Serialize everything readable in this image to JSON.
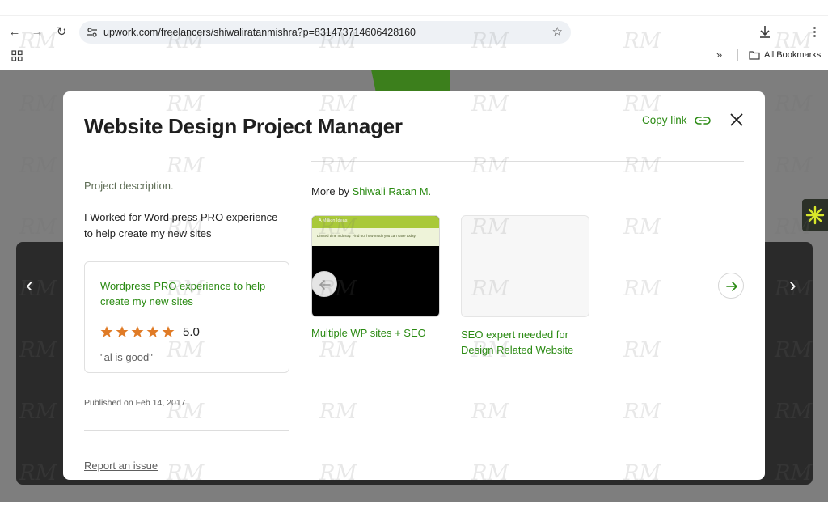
{
  "browser": {
    "url": "upwork.com/freelancers/shiwaliratanmishra?p=831473714606428160",
    "bookmarks_label": "All Bookmarks",
    "icons": [
      "back-icon",
      "forward-icon",
      "reload-icon",
      "site-settings-icon",
      "star-icon",
      "download-icon",
      "menu-icon",
      "apps-icon",
      "chevron-double-icon",
      "folder-icon"
    ]
  },
  "modal": {
    "title": "Website Design Project Manager",
    "copy_link_label": "Copy link",
    "project_description_label": "Project description.",
    "project_description": "I Worked for Word press PRO experience to help create my new sites",
    "review": {
      "title": "Wordpress PRO experience to help create my new sites",
      "stars": 5,
      "rating": "5.0",
      "quote": "\"al is good\""
    },
    "published": "Published on Feb 14, 2017",
    "report_label": "Report an issue",
    "more_by_prefix": "More by",
    "more_by_author": "Shiwali Ratan M.",
    "thumbnail_header": "A Million Ideas",
    "thumbnail_subtext": "Limited time Industry. Find out how much you can save today.",
    "related": [
      {
        "title": "Multiple WP sites + SEO"
      },
      {
        "title": "SEO expert needed for Design Related Website"
      }
    ]
  },
  "watermark": "RM",
  "colors": {
    "accent_green": "#2a8a12",
    "star_orange": "#e07b26",
    "backdrop": "#7e7e7e",
    "dark_band": "#2a2a2a"
  }
}
